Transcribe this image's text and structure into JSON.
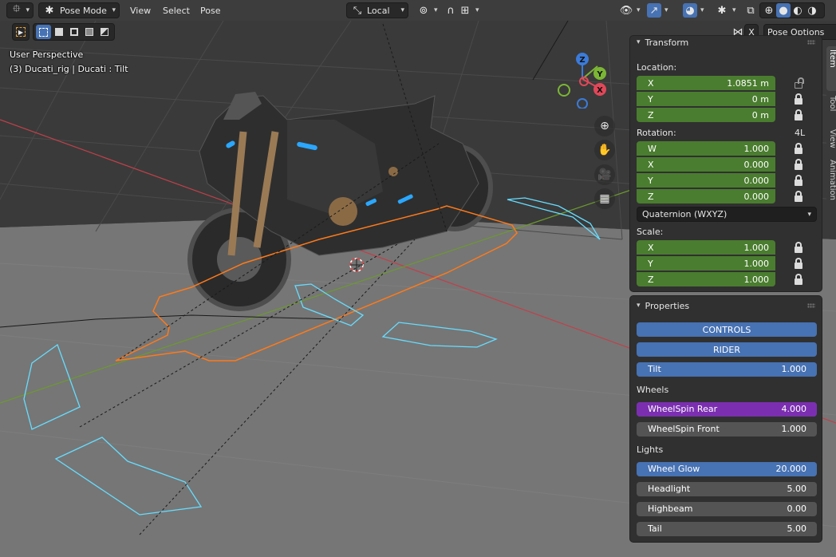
{
  "header": {
    "editor_type_icon": "transform-gizmo-icon",
    "mode_label": "Pose Mode",
    "menus": [
      "View",
      "Select",
      "Pose"
    ],
    "orientation_label": "Local",
    "icons": [
      "pivot-icon",
      "snap-icon",
      "proportional-icon",
      "visibility-icon",
      "gizmo-icon",
      "overlay-icon",
      "xray-icon",
      "wireframe-shading-icon",
      "solid-shading-icon",
      "material-shading-icon",
      "rendered-shading-icon"
    ]
  },
  "toolbar2": {
    "mirror_x_label": "X",
    "pose_options_label": "Pose Options"
  },
  "viewport": {
    "perspective_label": "User Perspective",
    "object_label": "(3) Ducati_rig | Ducati : Tilt",
    "gizmo": {
      "x": "X",
      "y": "Y",
      "z": "Z"
    },
    "colors": {
      "x_axis": "#e04859",
      "y_axis": "#7bb635",
      "z_axis": "#3b7bd9",
      "floor": "#6b6b6b"
    }
  },
  "n_panel": {
    "tabs": [
      "Item",
      "Tool",
      "View",
      "Animation"
    ],
    "transform": {
      "title": "Transform",
      "location_label": "Location:",
      "location": [
        {
          "axis": "X",
          "value": "1.0851 m"
        },
        {
          "axis": "Y",
          "value": "0 m"
        },
        {
          "axis": "Z",
          "value": "0 m"
        }
      ],
      "rotation_label": "Rotation:",
      "rotation_lock_label": "4L",
      "rotation": [
        {
          "axis": "W",
          "value": "1.000"
        },
        {
          "axis": "X",
          "value": "0.000"
        },
        {
          "axis": "Y",
          "value": "0.000"
        },
        {
          "axis": "Z",
          "value": "0.000"
        }
      ],
      "rotation_mode": "Quaternion (WXYZ)",
      "scale_label": "Scale:",
      "scale": [
        {
          "axis": "X",
          "value": "1.000"
        },
        {
          "axis": "Y",
          "value": "1.000"
        },
        {
          "axis": "Z",
          "value": "1.000"
        }
      ]
    },
    "properties": {
      "title": "Properties",
      "controls_label": "CONTROLS",
      "rider_label": "RIDER",
      "tilt": {
        "label": "Tilt",
        "value": "1.000",
        "fill": 1.0
      },
      "wheels_label": "Wheels",
      "wheel_spin_rear": {
        "label": "WheelSpin Rear",
        "value": "4.000",
        "fill": 1.0
      },
      "wheel_spin_front": {
        "label": "WheelSpin Front",
        "value": "1.000",
        "fill": 0.0
      },
      "lights_label": "Lights",
      "wheel_glow": {
        "label": "Wheel Glow",
        "value": "20.000",
        "fill": 1.0
      },
      "headlight": {
        "label": "Headlight",
        "value": "5.00",
        "fill": 0.0
      },
      "highbeam": {
        "label": "Highbeam",
        "value": "0.00",
        "fill": 0.0
      },
      "tail": {
        "label": "Tail",
        "value": "5.00",
        "fill": 0.0
      }
    },
    "colors": {
      "field_green": "#4a7d2f",
      "button_blue": "#4772b3",
      "purple": "#7b2fb0"
    }
  }
}
